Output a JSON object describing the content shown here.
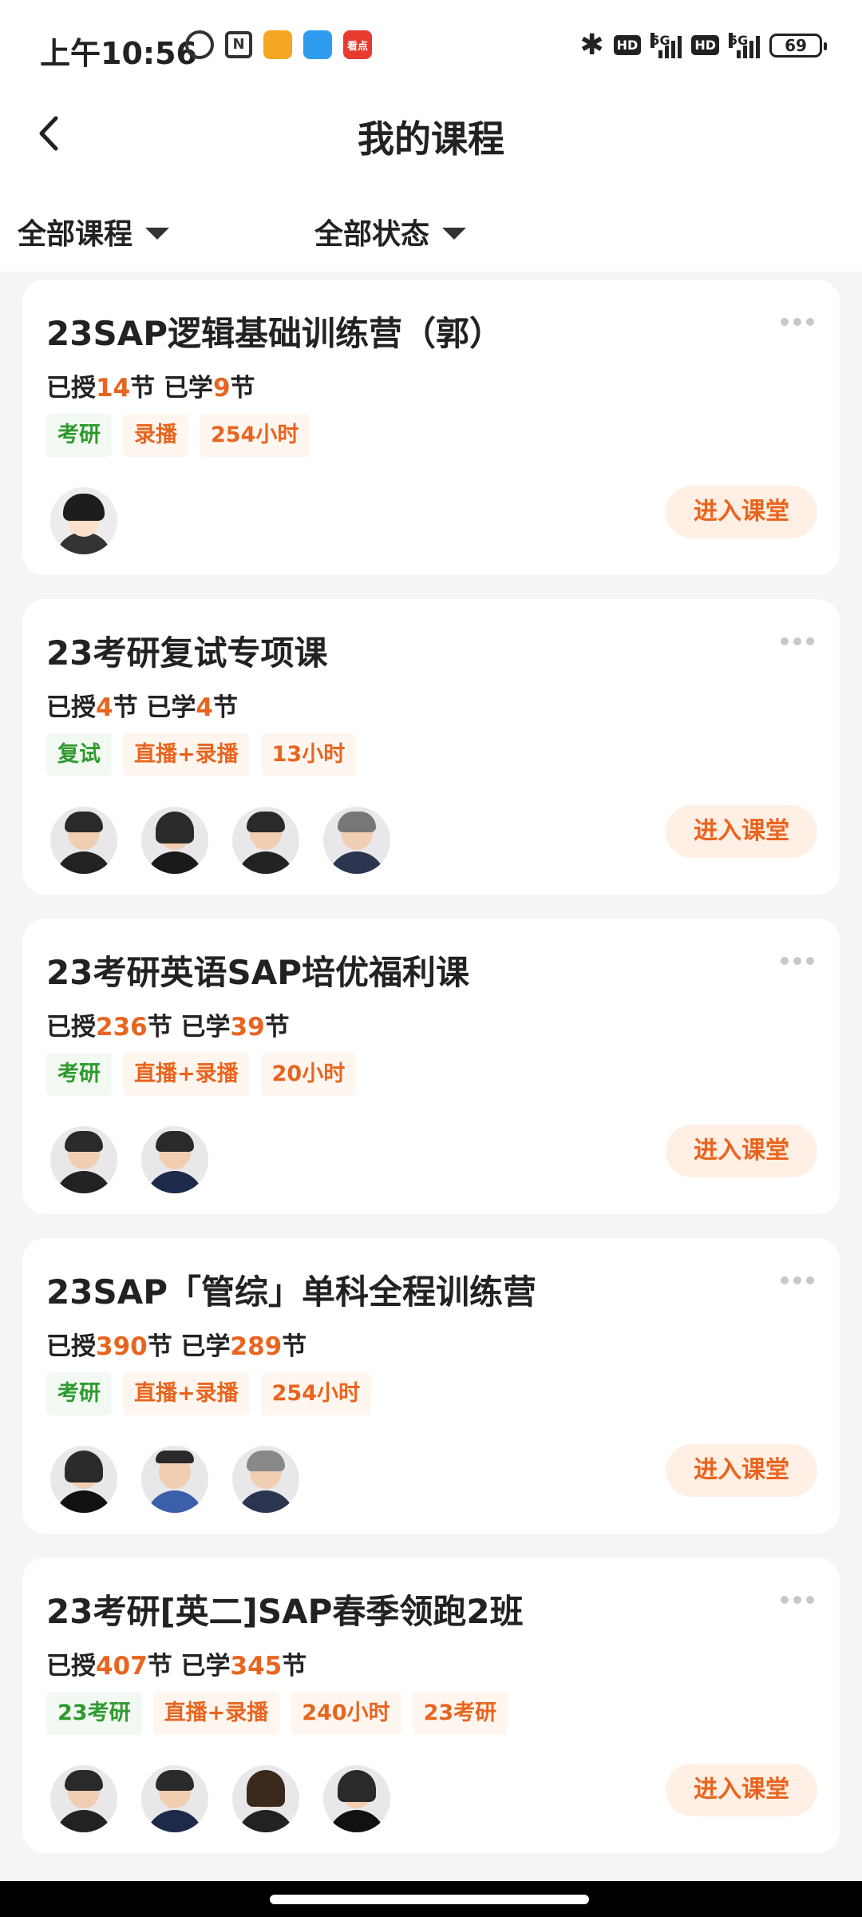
{
  "status_bar": {
    "time": "上午10:56",
    "apps": [
      {
        "icon": "notes-app-icon",
        "color": "#f5a623"
      },
      {
        "icon": "blue-app-icon",
        "color": "#2f9cf0"
      },
      {
        "icon": "red-app-icon",
        "color": "#e63b2e",
        "label": "看点"
      }
    ],
    "hd": "HD",
    "network": "5G",
    "battery": "69"
  },
  "header": {
    "title": "我的课程"
  },
  "filters": {
    "course_filter": "全部课程",
    "status_filter": "全部状态"
  },
  "labels": {
    "taught_prefix": "已授",
    "studied_prefix": "已学",
    "unit": "节",
    "enter_button": "进入课堂"
  },
  "courses": [
    {
      "title": "23SAP逻辑基础训练营（郭）",
      "taught": "14",
      "studied": "9",
      "tags": [
        {
          "text": "考研",
          "color": "green"
        },
        {
          "text": "录播",
          "color": "orange"
        },
        {
          "text": "254小时",
          "color": "orange"
        }
      ],
      "teachers": 1
    },
    {
      "title": "23考研复试专项课",
      "taught": "4",
      "studied": "4",
      "tags": [
        {
          "text": "复试",
          "color": "green"
        },
        {
          "text": "直播+录播",
          "color": "orange"
        },
        {
          "text": "13小时",
          "color": "orange"
        }
      ],
      "teachers": 4
    },
    {
      "title": "23考研英语SAP培优福利课",
      "taught": "236",
      "studied": "39",
      "tags": [
        {
          "text": "考研",
          "color": "green"
        },
        {
          "text": "直播+录播",
          "color": "orange"
        },
        {
          "text": "20小时",
          "color": "orange"
        }
      ],
      "teachers": 2
    },
    {
      "title": "23SAP「管综」单科全程训练营",
      "taught": "390",
      "studied": "289",
      "tags": [
        {
          "text": "考研",
          "color": "green"
        },
        {
          "text": "直播+录播",
          "color": "orange"
        },
        {
          "text": "254小时",
          "color": "orange"
        }
      ],
      "teachers": 3
    },
    {
      "title": "23考研[英二]SAP春季领跑2班",
      "taught": "407",
      "studied": "345",
      "tags": [
        {
          "text": "23考研",
          "color": "green"
        },
        {
          "text": "直播+录播",
          "color": "orange"
        },
        {
          "text": "240小时",
          "color": "orange"
        },
        {
          "text": "23考研",
          "color": "orange"
        }
      ],
      "teachers": 4
    }
  ]
}
